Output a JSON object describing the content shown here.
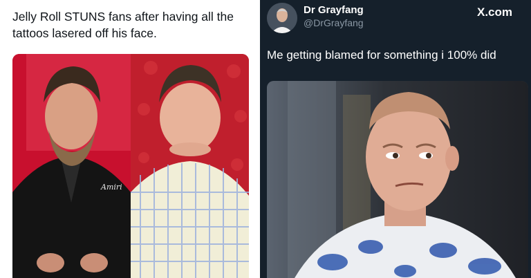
{
  "left_post": {
    "caption": "Jelly Roll STUNS fans after having all the tattoos lasered off his face.",
    "photo_jacket_text": "Amiri"
  },
  "right_post": {
    "name": "Dr Grayfang",
    "handle": "@DrGrayfang",
    "brand": "X.com",
    "text": "Me getting blamed for something i 100% did"
  }
}
